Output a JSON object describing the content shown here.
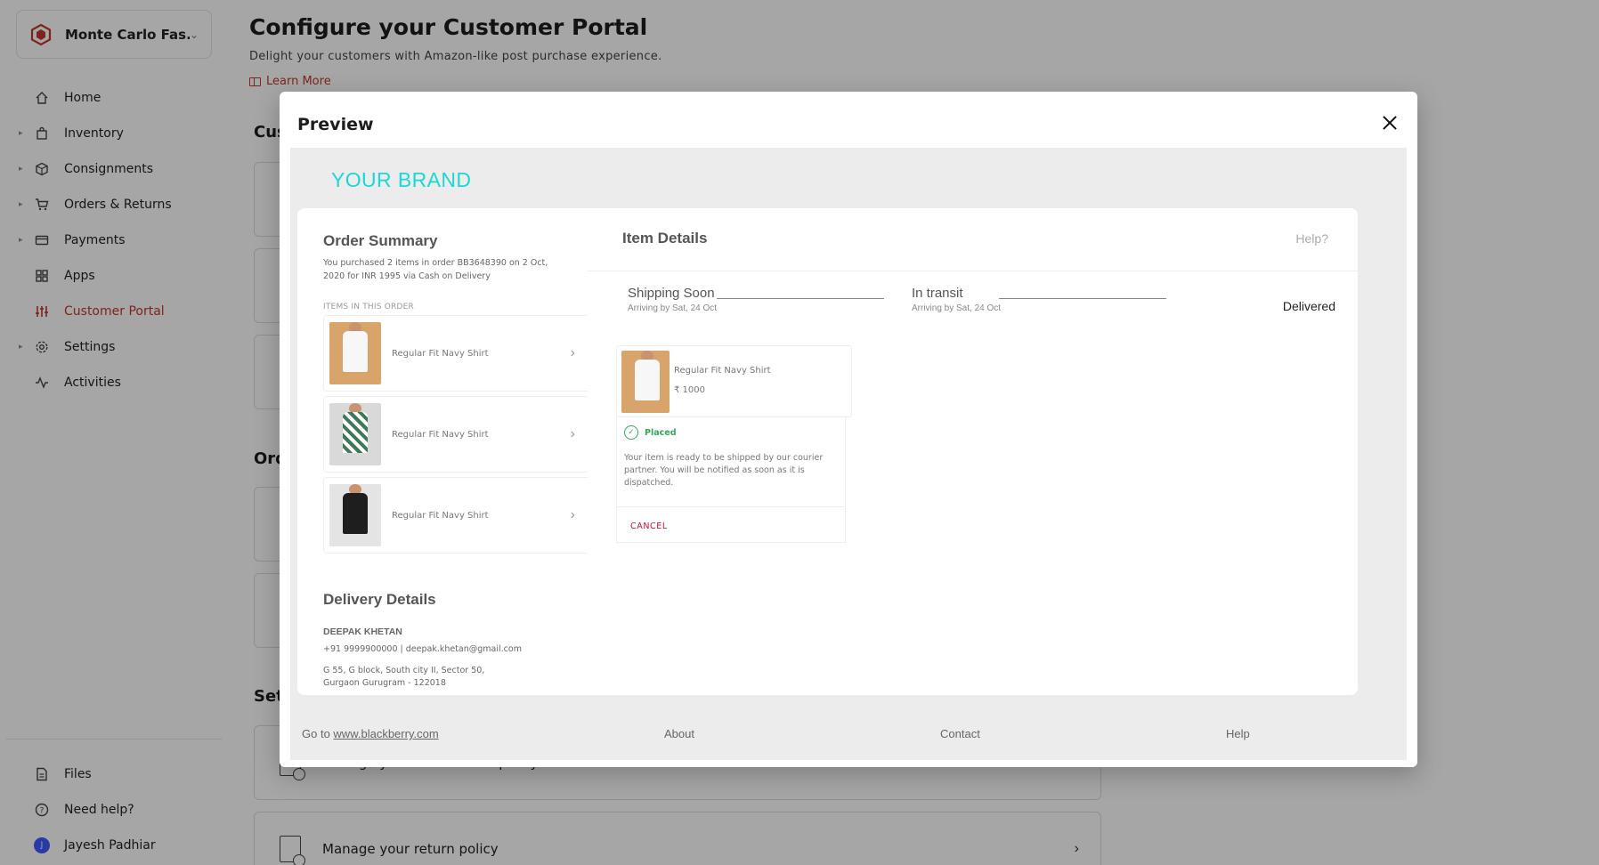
{
  "sidebar": {
    "org_name": "Monte Carlo Fas...",
    "items": [
      {
        "label": "Home"
      },
      {
        "label": "Inventory"
      },
      {
        "label": "Consignments"
      },
      {
        "label": "Orders & Returns"
      },
      {
        "label": "Payments"
      },
      {
        "label": "Apps"
      },
      {
        "label": "Customer Portal"
      },
      {
        "label": "Settings"
      },
      {
        "label": "Activities"
      }
    ],
    "bottom": [
      {
        "label": "Files"
      },
      {
        "label": "Need help?"
      },
      {
        "label": "Jayesh Padhiar",
        "initial": "J"
      }
    ]
  },
  "main": {
    "title": "Configure your Customer Portal",
    "subtitle": "Delight your customers with Amazon-like post purchase experience.",
    "learn_more": "Learn More",
    "sections": [
      "Cus",
      "Ord",
      "Set"
    ],
    "cards": [
      "Manage your cancellation policy",
      "Manage your return policy"
    ]
  },
  "modal": {
    "title": "Preview",
    "preview": {
      "brand": "YOUR BRAND",
      "order_summary": {
        "heading": "Order Summary",
        "text": "You purchased 2 items in order BB3648390 on 2 Oct, 2020 for INR 1995 via Cash on Delivery",
        "items_caption": "ITEMS IN THIS ORDER",
        "items": [
          {
            "name": "Regular Fit Navy Shirt"
          },
          {
            "name": "Regular Fit Navy Shirt"
          },
          {
            "name": "Regular Fit Navy Shirt"
          }
        ]
      },
      "delivery": {
        "heading": "Delivery Details",
        "name": "DEEPAK KHETAN",
        "contact": "+91 9999900000 | deepak.khetan@gmail.com",
        "address": "G 55, G block, South city II, Sector 50, Gurgaon Gurugram - 122018"
      },
      "item_details": {
        "title": "Item Details",
        "help": "Help?",
        "stages": [
          {
            "name": "Shipping Soon",
            "date": "Arriving by Sat, 24 Oct"
          },
          {
            "name": "In transit",
            "date": "Arriving by Sat, 24 Oct"
          },
          {
            "name": "Delivered"
          }
        ],
        "item": {
          "name": "Regular Fit Navy Shirt",
          "price": "₹ 1000",
          "status": "Placed",
          "message": "Your item is ready to be shipped by our courier partner. You will be notified as soon as it is dispatched.",
          "cancel": "CANCEL"
        }
      },
      "footer": {
        "go_to": "Go to",
        "site": "www.blackberry.com",
        "about": "About",
        "contact": "Contact",
        "help": "Help"
      }
    }
  },
  "colors": {
    "accent": "#c0392b",
    "brand": "#1fd6d6",
    "placed": "#2eaa5b",
    "cancel": "#c8102e"
  }
}
